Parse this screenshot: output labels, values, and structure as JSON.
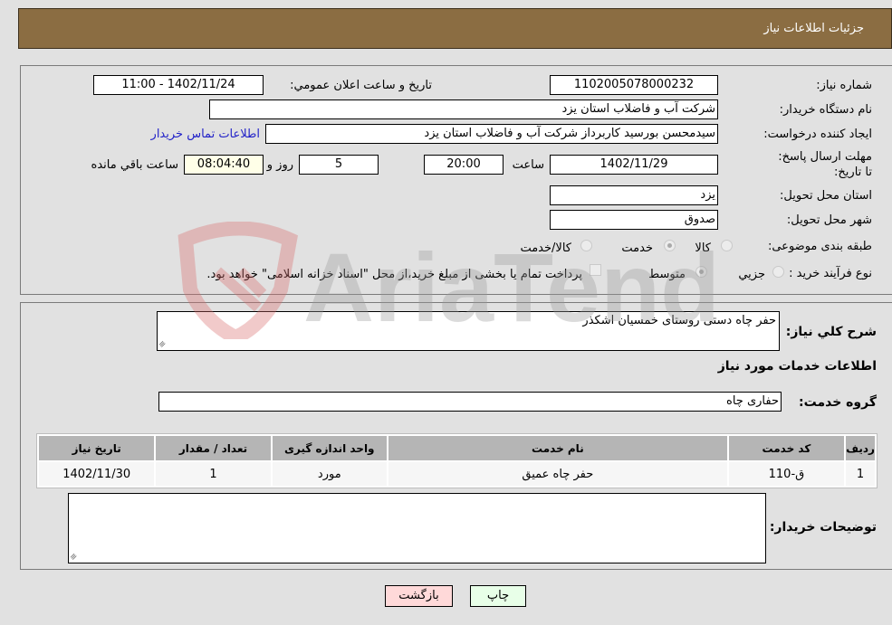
{
  "header": {
    "title": "جزئیات اطلاعات نیاز"
  },
  "details": {
    "need_number": {
      "label": "شماره نیاز:",
      "value": "1102005078000232"
    },
    "announce_datetime": {
      "label": "تاریخ و ساعت اعلان عمومي:",
      "value": "1402/11/24 - 11:00"
    },
    "buyer_org": {
      "label": "نام دستگاه خریدار:",
      "value": "شرکت آب و فاضلاب استان یزد"
    },
    "requester": {
      "label": "ایجاد کننده درخواست:",
      "value": "سیدمحسن بورسید کاربرداز شرکت آب و فاضلاب استان یزد"
    },
    "contact_link": "اطلاعات تماس خریدار",
    "deadline": {
      "label": "مهلت ارسال پاسخ: تا تاریخ:",
      "date": "1402/11/29",
      "time_label": "ساعت",
      "time": "20:00",
      "days": "5",
      "days_label": "روز و",
      "remaining": "08:04:40",
      "remaining_label": "ساعت باقي مانده"
    },
    "delivery_province": {
      "label": "استان محل تحویل:",
      "value": "یزد"
    },
    "delivery_city": {
      "label": "شهر محل تحویل:",
      "value": "صدوق"
    },
    "category": {
      "label": "طبقه بندی موضوعی:",
      "options": [
        "کالا",
        "خدمت",
        "کالا/خدمت"
      ],
      "selected": "خدمت"
    },
    "purchase_type": {
      "label": "نوع فرآیند خرید :",
      "options": [
        "جزيي",
        "متوسط"
      ],
      "selected": "متوسط",
      "treasury_note": "پرداخت تمام یا بخشی از مبلغ خرید،از محل \"اسناد خزانه اسلامی\" خواهد بود.",
      "treasury_checked": false
    }
  },
  "summary": {
    "label": "شرح کلي نیاز:",
    "value": "حفر چاه دستی روستای خمسیان اشکذر"
  },
  "services": {
    "section_title": "اطلاعات خدمات مورد نیاز",
    "group_label": "گروه خدمت:",
    "group_value": "حفاری چاه",
    "columns": [
      "ردیف",
      "کد خدمت",
      "نام خدمت",
      "واحد اندازه گیری",
      "تعداد / مقدار",
      "تاریخ نیاز"
    ],
    "rows": [
      [
        "1",
        "ق-110",
        "حفر چاه عمیق",
        "مورد",
        "1",
        "1402/11/30"
      ]
    ]
  },
  "buyer_notes": {
    "label": "توضیحات خریدار:",
    "value": ""
  },
  "buttons": {
    "print": "چاپ",
    "back": "بازگشت"
  },
  "watermark": "AriaTender.neT"
}
